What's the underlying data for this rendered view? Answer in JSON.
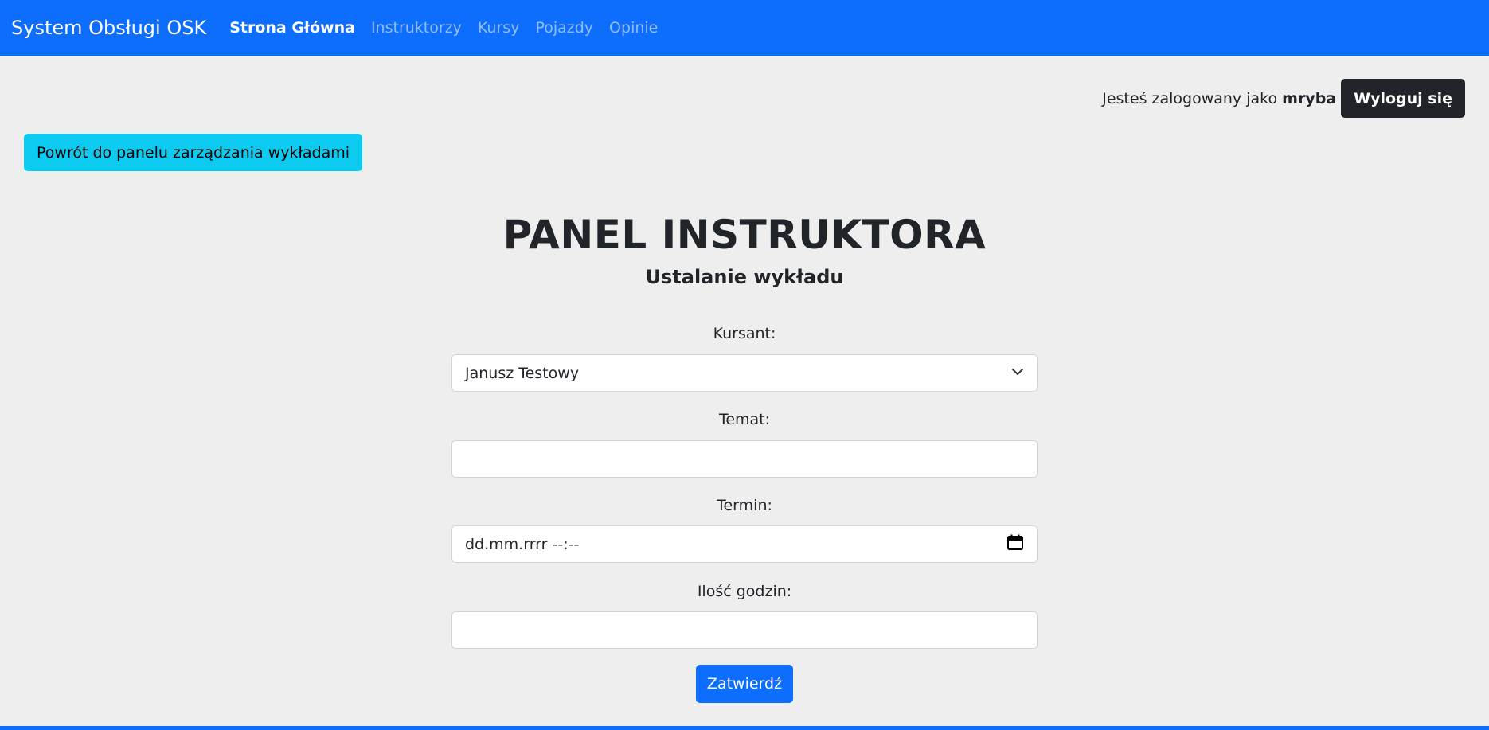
{
  "navbar": {
    "brand": "System Obsługi OSK",
    "links": [
      "Strona Główna",
      "Instruktorzy",
      "Kursy",
      "Pojazdy",
      "Opinie"
    ],
    "active_index": 0,
    "color": "#0d6efd"
  },
  "user": {
    "prefix": "Jesteś zalogowany jako",
    "username": "mryba",
    "logout_label": "Wyloguj się"
  },
  "back_button": {
    "label": "Powrót do panelu zarządzania wykładami"
  },
  "page": {
    "title": "PANEL INSTRUKTORA",
    "subtitle": "Ustalanie wykładu"
  },
  "form": {
    "student_label": "Kursant:",
    "student_value": "Janusz Testowy",
    "topic_label": "Temat:",
    "topic_value": "",
    "date_label": "Termin:",
    "date_value": "dd.mm.rrrr --:--",
    "hours_label": "Ilość godzin:",
    "hours_value": "",
    "submit_label": "Zatwierdź"
  },
  "icons": {
    "select": "chevron-down-icon",
    "date": "calendar-icon"
  }
}
